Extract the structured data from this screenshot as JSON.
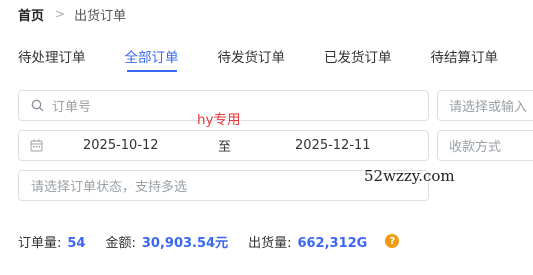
{
  "breadcrumb": {
    "home": "首页",
    "separator": ">",
    "current": "出货订单"
  },
  "tabs": [
    {
      "label": "待处理订单"
    },
    {
      "label": "全部订单",
      "active": true
    },
    {
      "label": "待发货订单"
    },
    {
      "label": "已发货订单"
    },
    {
      "label": "待结算订单"
    }
  ],
  "filters": {
    "order_no_placeholder": "订单号",
    "right_select_1_placeholder": "请选择或输入",
    "date_start": "2025-10-12",
    "date_separator": "至",
    "date_end": "2025-12-11",
    "payment_placeholder": "收款方式",
    "status_placeholder": "请选择订单状态，支持多选"
  },
  "watermarks": {
    "tag": "hy专用",
    "site": "52wzzy.com"
  },
  "summary": {
    "order_count_label": "订单量:",
    "order_count_value": "54",
    "amount_label": "金额:",
    "amount_value": "30,903.54元",
    "shipment_label": "出货量:",
    "shipment_value": "662,312G",
    "help_icon_text": "?"
  },
  "colors": {
    "accent": "#3a67f3",
    "border": "#dcdfe6",
    "help_icon": "#f39c12",
    "watermark": "#e53935"
  }
}
